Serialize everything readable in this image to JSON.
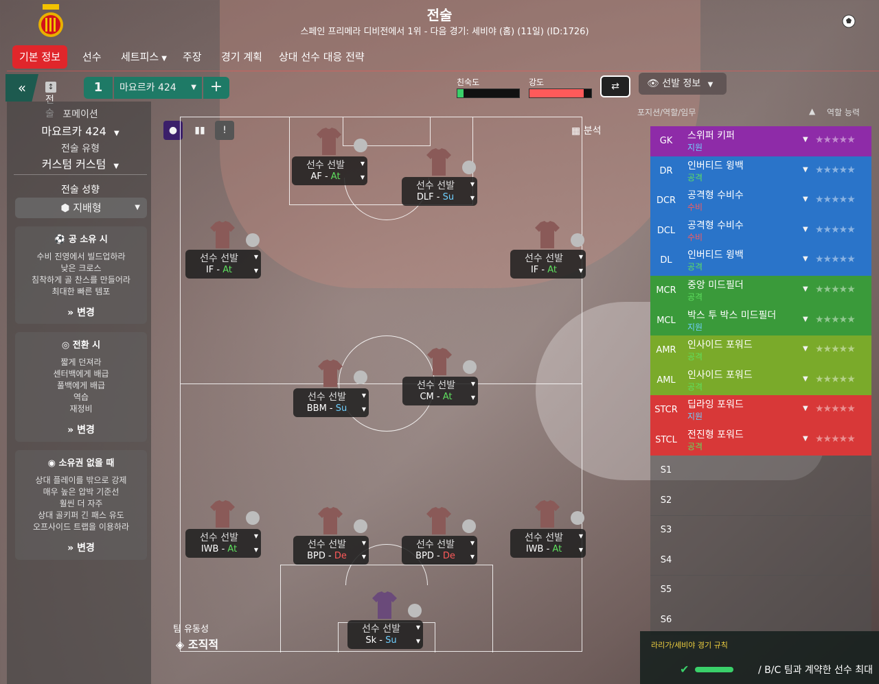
{
  "header": {
    "title": "전술",
    "subtitle": "스페인 프리메라 디비전에서 1위 - 다음 경기: 세비야 (홈) (11일) (ID:1726)"
  },
  "nav": {
    "items": [
      {
        "label": "기본 정보",
        "active": true
      },
      {
        "label": "선수"
      },
      {
        "label": "세트피스"
      },
      {
        "label": "주장"
      },
      {
        "label": "경기 계획"
      },
      {
        "label": "상대 선수 대응 전략"
      }
    ]
  },
  "tactic_bar": {
    "tactic_label": "전술",
    "slot_number": "1",
    "tactic_name": "마요르카 424",
    "familiarity_label": "친숙도",
    "intensity_label": "강도",
    "familiarity_level": 0.1,
    "intensity_level": 0.88,
    "lineup_info_label": "선발 정보"
  },
  "left_panel": {
    "formation_label": "포메이션",
    "formation_value": "마요르카 424",
    "tactic_style_label": "전술 유형",
    "tactic_style_value": "커스텀 커스텀",
    "mentality_label": "전술 성향",
    "mentality_value": "지배형",
    "in_possession": {
      "title": "공 소유 시",
      "items": [
        "수비 진영에서 빌드업하라",
        "낮은 크로스",
        "침착하게 골 찬스를 만들어라",
        "최대한 빠른 템포"
      ],
      "change": "변경"
    },
    "in_transition": {
      "title": "전환 시",
      "items": [
        "짧게 던져라",
        "센터백에게 배급",
        "풀백에게 배급",
        "역습",
        "재정비"
      ],
      "change": "변경"
    },
    "out_of_possession": {
      "title": "소유권 없을 때",
      "items": [
        "상대 플레이를 밖으로 강제",
        "매우 높은 압박 기준선",
        "훨씬 더 자주",
        "상대 골키퍼 긴 패스 유도",
        "오프사이드 트랩을 이용하라"
      ],
      "change": "변경"
    }
  },
  "pitch": {
    "analysis_label": "분석",
    "team_fluidity_label": "팀 유동성",
    "team_fluidity_value": "조직적",
    "players": [
      {
        "name": "선수 선발",
        "role": "AF",
        "duty": "At"
      },
      {
        "name": "선수 선발",
        "role": "DLF",
        "duty": "Su"
      },
      {
        "name": "선수 선발",
        "role": "IF",
        "duty": "At"
      },
      {
        "name": "선수 선발",
        "role": "IF",
        "duty": "At"
      },
      {
        "name": "선수 선발",
        "role": "BBM",
        "duty": "Su"
      },
      {
        "name": "선수 선발",
        "role": "CM",
        "duty": "At"
      },
      {
        "name": "선수 선발",
        "role": "IWB",
        "duty": "At"
      },
      {
        "name": "선수 선발",
        "role": "BPD",
        "duty": "De"
      },
      {
        "name": "선수 선발",
        "role": "BPD",
        "duty": "De"
      },
      {
        "name": "선수 선발",
        "role": "IWB",
        "duty": "At"
      },
      {
        "name": "선수 선발",
        "role": "Sk",
        "duty": "Su"
      }
    ]
  },
  "right_panel": {
    "header_left": "포지션/역할/임무",
    "header_right": "역할 능력",
    "positions": [
      {
        "code": "GK",
        "role": "스위퍼 키퍼",
        "duty": "지원",
        "color": "#8e2ba8",
        "duty_color": "#6fd0ff"
      },
      {
        "code": "DR",
        "role": "인버티드 윙백",
        "duty": "공격",
        "color": "#2a74c9",
        "duty_color": "#5fe05f"
      },
      {
        "code": "DCR",
        "role": "공격형 수비수",
        "duty": "수비",
        "color": "#2a74c9",
        "duty_color": "#ff5a5a"
      },
      {
        "code": "DCL",
        "role": "공격형 수비수",
        "duty": "수비",
        "color": "#2a74c9",
        "duty_color": "#ff5a5a"
      },
      {
        "code": "DL",
        "role": "인버티드 윙백",
        "duty": "공격",
        "color": "#2a74c9",
        "duty_color": "#5fe05f"
      },
      {
        "code": "MCR",
        "role": "중앙 미드필더",
        "duty": "공격",
        "color": "#3a9a3a",
        "duty_color": "#5fe05f"
      },
      {
        "code": "MCL",
        "role": "박스 투 박스 미드필더",
        "duty": "지원",
        "color": "#3a9a3a",
        "duty_color": "#6fd0ff"
      },
      {
        "code": "AMR",
        "role": "인사이드 포워드",
        "duty": "공격",
        "color": "#7aaa2a",
        "duty_color": "#5fe05f"
      },
      {
        "code": "AML",
        "role": "인사이드 포워드",
        "duty": "공격",
        "color": "#7aaa2a",
        "duty_color": "#5fe05f"
      },
      {
        "code": "STCR",
        "role": "딥라잉 포워드",
        "duty": "지원",
        "color": "#d83838",
        "duty_color": "#6fd0ff"
      },
      {
        "code": "STCL",
        "role": "전진형 포워드",
        "duty": "공격",
        "color": "#d83838",
        "duty_color": "#5fe05f"
      }
    ],
    "subs": [
      "S1",
      "S2",
      "S3",
      "S4",
      "S5",
      "S6"
    ],
    "stars": "★★★★★",
    "rules_title": "라리가/세비야 경기 규칙",
    "rules_text": "/  B/C 팀과 계약한 선수 최대"
  },
  "colors": {
    "accent_red": "#e0262b",
    "accent_green": "#1e7a66"
  }
}
